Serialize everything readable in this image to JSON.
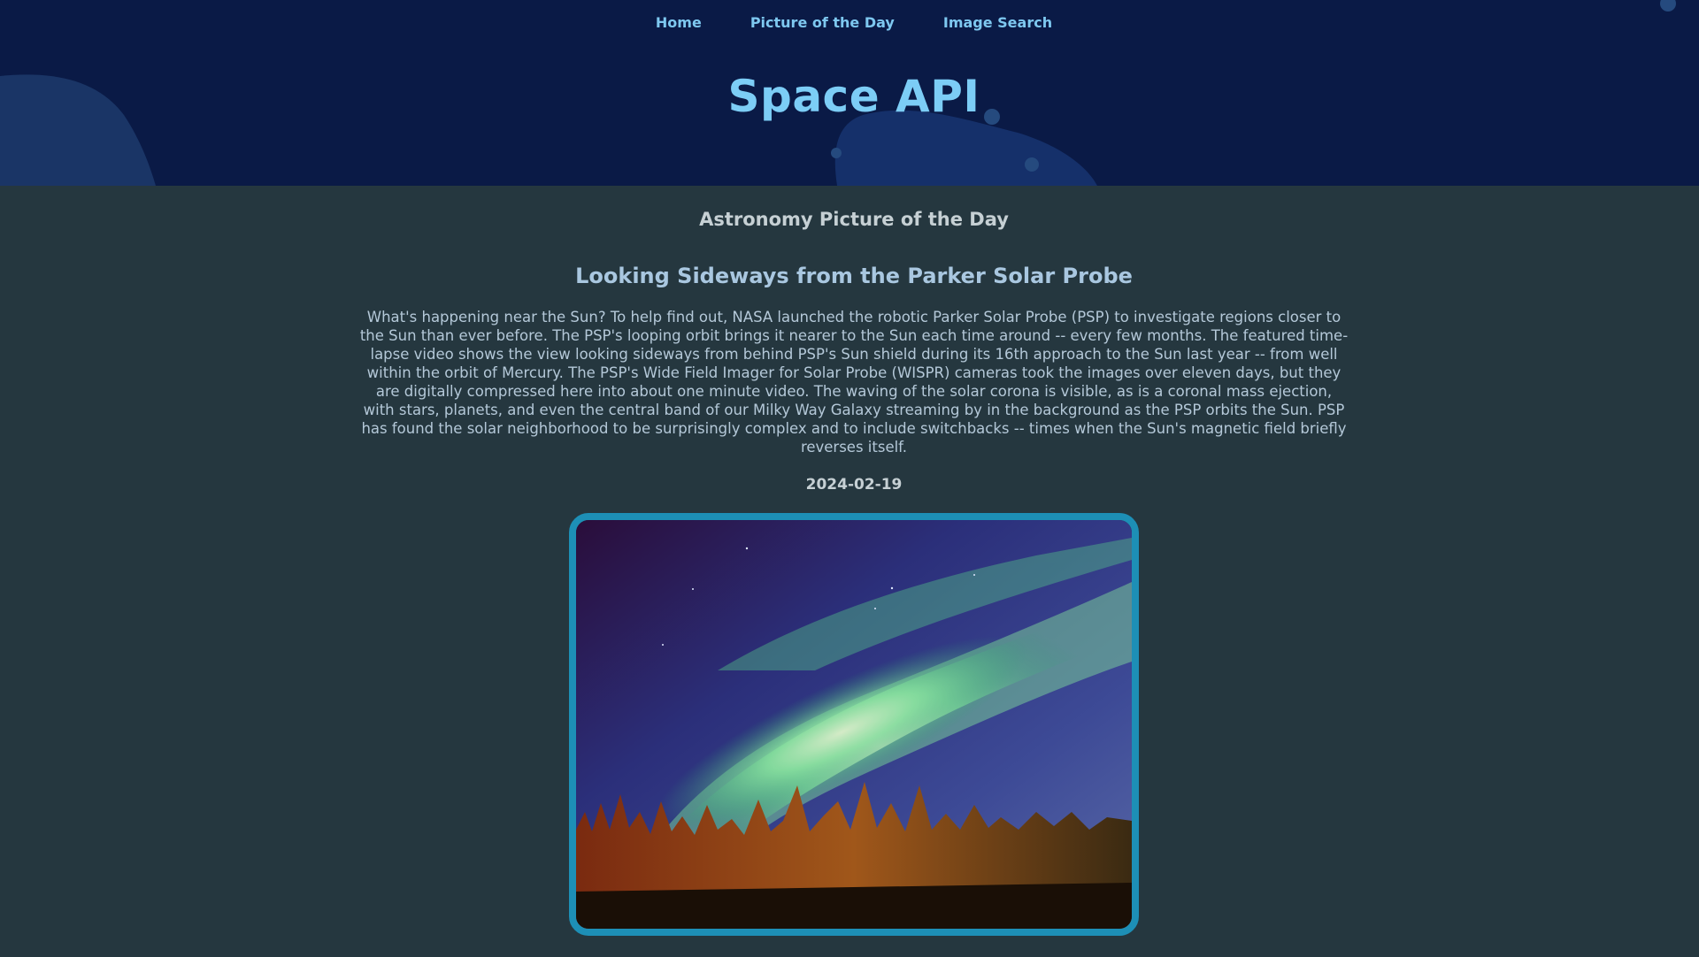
{
  "nav": {
    "items": [
      {
        "label": "Home"
      },
      {
        "label": "Picture of the Day"
      },
      {
        "label": "Image Search"
      }
    ]
  },
  "header": {
    "site_title": "Space API"
  },
  "main": {
    "section_heading": "Astronomy Picture of the Day",
    "apod": {
      "title": "Looking Sideways from the Parker Solar Probe",
      "explanation": "What's happening near the Sun? To help find out, NASA launched the robotic Parker Solar Probe (PSP) to investigate regions closer to the Sun than ever before. The PSP's looping orbit brings it nearer to the Sun each time around -- every few months. The featured time-lapse video shows the view looking sideways from behind PSP's Sun shield during its 16th approach to the Sun last year -- from well within the orbit of Mercury. The PSP's Wide Field Imager for Solar Probe (WISPR) cameras took the images over eleven days, but they are digitally compressed here into about one minute video. The waving of the solar corona is visible, as is a coronal mass ejection, with stars, planets, and even the central band of our Milky Way Galaxy streaming by in the background as the PSP orbits the Sun. PSP has found the solar neighborhood to be surprisingly complex and to include switchbacks -- times when the Sun's magnetic field briefly reverses itself.",
      "date": "2024-02-19"
    }
  },
  "colors": {
    "header_bg": "#0a1a46",
    "page_bg": "#25373f",
    "accent": "#7ccdf6",
    "image_border": "#1d8fb6"
  }
}
